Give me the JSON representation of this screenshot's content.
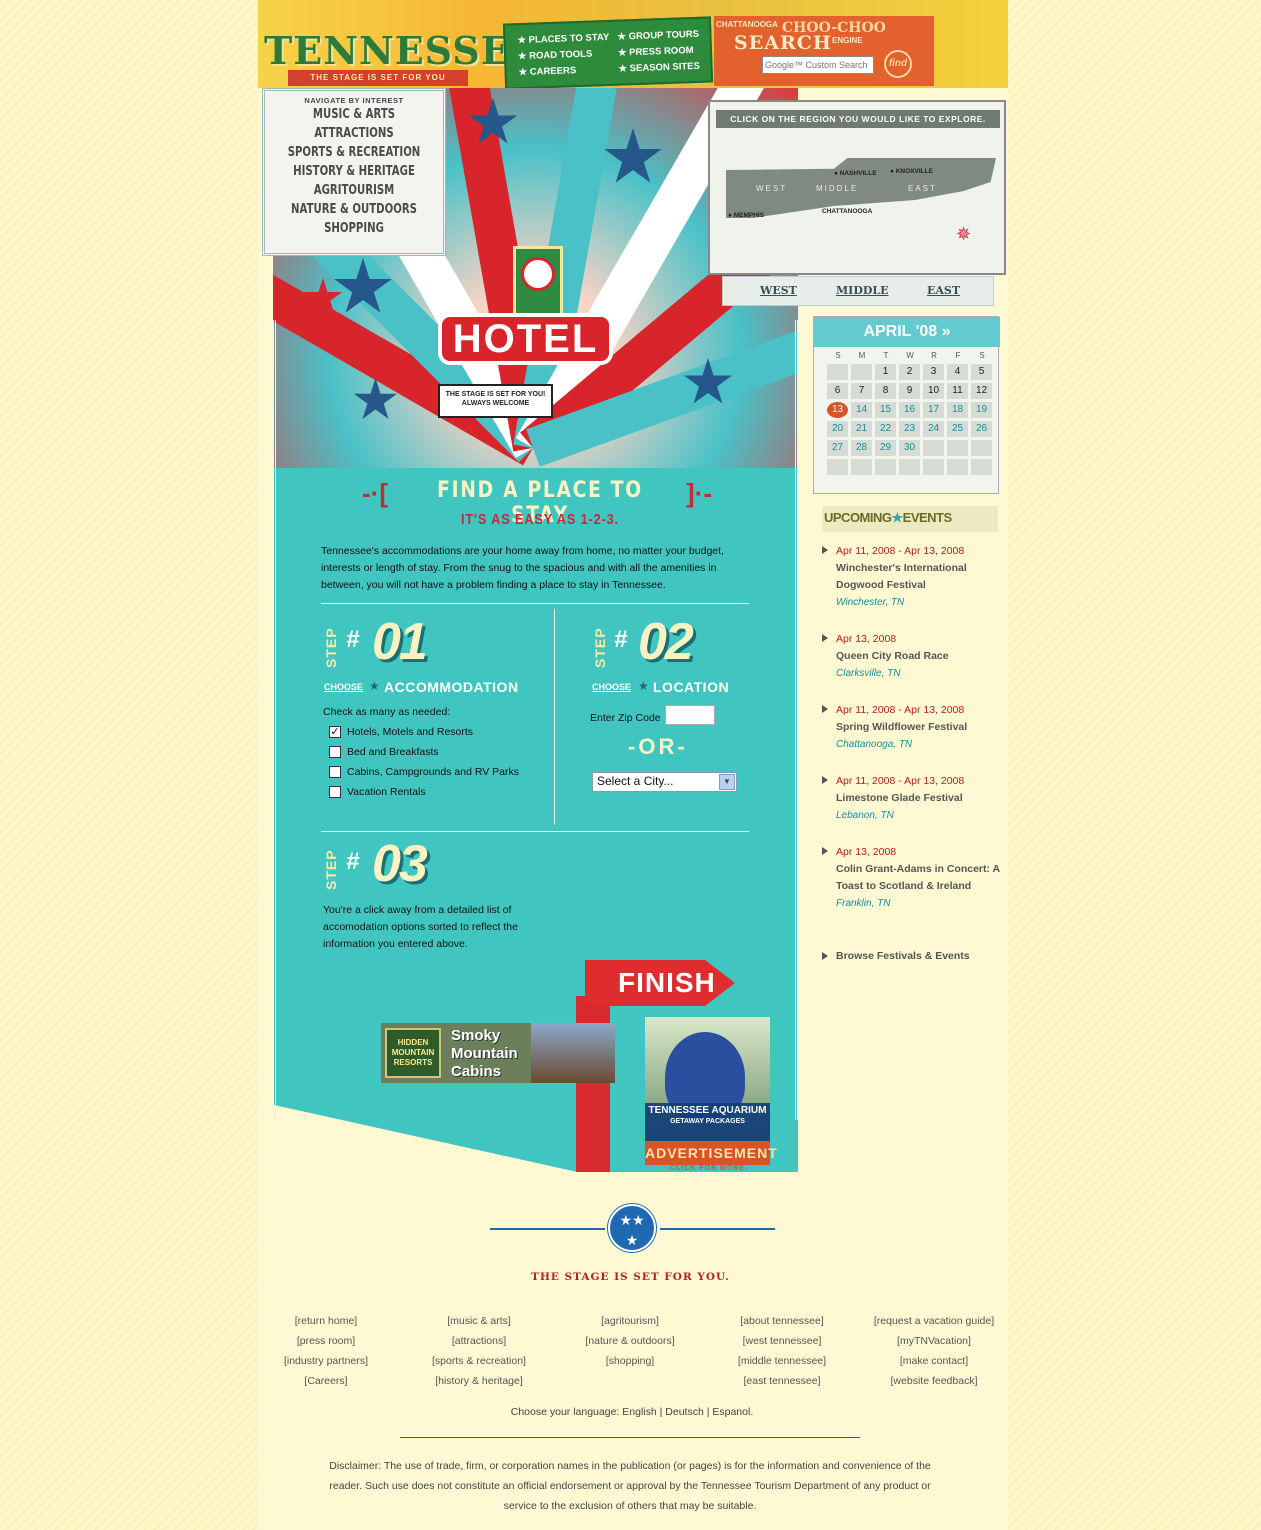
{
  "header": {
    "logo_text": "TENNESSEE",
    "logo_tagline": "THE STAGE IS SET FOR YOU",
    "nav": [
      "PLACES TO STAY",
      "GROUP TOURS",
      "ROAD TOOLS",
      "PRESS ROOM",
      "CAREERS",
      "SEASON SITES"
    ],
    "search_brand_small": "CHATTANOOGA",
    "search_brand_big": "CHOO-CHOO",
    "search_brand_engine": "ENGINE",
    "search_title": "SEARCH",
    "search_placeholder": "Google™ Custom Search",
    "find_label": "find"
  },
  "interest_nav": {
    "label": "NAVIGATE BY INTEREST",
    "items": [
      "MUSIC & ARTS",
      "ATTRACTIONS",
      "SPORTS & RECREATION",
      "HISTORY & HERITAGE",
      "AGRITOURISM",
      "NATURE & OUTDOORS",
      "SHOPPING"
    ]
  },
  "hero": {
    "sign_text": "HOTEL",
    "welcome_text": "THE STAGE IS SET FOR YOU! ALWAYS WELCOME"
  },
  "map": {
    "heading": "CLICK ON THE REGION YOU WOULD LIKE TO EXPLORE.",
    "regions": [
      "WEST",
      "MIDDLE",
      "EAST"
    ],
    "cities": [
      "NASHVILLE",
      "KNOXVILLE",
      "MEMPHIS",
      "CHATTANOOGA"
    ],
    "tabs": [
      "WEST",
      "MIDDLE",
      "EAST"
    ]
  },
  "calendar": {
    "title": "APRIL '08 »",
    "dow": [
      "S",
      "M",
      "T",
      "W",
      "R",
      "F",
      "S"
    ],
    "today": "13",
    "weeks": [
      [
        "",
        "",
        "1",
        "2",
        "3",
        "4",
        "5"
      ],
      [
        "6",
        "7",
        "8",
        "9",
        "10",
        "11",
        "12"
      ],
      [
        "13",
        "14",
        "15",
        "16",
        "17",
        "18",
        "19"
      ],
      [
        "20",
        "21",
        "22",
        "23",
        "24",
        "25",
        "26"
      ],
      [
        "27",
        "28",
        "29",
        "30",
        "",
        "",
        ""
      ],
      [
        "",
        "",
        "",
        "",
        "",
        "",
        ""
      ]
    ]
  },
  "upcoming": {
    "title_a": "UPCOMING",
    "title_star": "★",
    "title_b": "EVENTS",
    "events": [
      {
        "date": "Apr 11, 2008 - Apr 13, 2008",
        "name": "Winchester's International Dogwood Festival",
        "location": "Winchester, TN"
      },
      {
        "date": "Apr 13, 2008",
        "name": "Queen City Road Race",
        "location": "Clarksville, TN"
      },
      {
        "date": "Apr 11, 2008 - Apr 13, 2008",
        "name": "Spring Wildflower Festival",
        "location": "Chattanooga, TN"
      },
      {
        "date": "Apr 11, 2008 - Apr 13, 2008",
        "name": "Limestone Glade Festival",
        "location": "Lebanon, TN"
      },
      {
        "date": "Apr 13, 2008",
        "name": "Colin Grant-Adams in Concert: A Toast to Scotland & Ireland",
        "location": "Franklin, TN"
      }
    ],
    "browse": "Browse Festivals & Events"
  },
  "main": {
    "title": "FIND A PLACE TO STAY",
    "subtitle": "IT'S AS EASY AS 1-2-3.",
    "intro": "Tennessee's accommodations are your home away from home, no matter your budget, interests or length of stay. From the snug to the spacious and with all the amenities in between, you will not have a problem finding a place to stay in Tennessee.",
    "step_word": "STEP",
    "step_hash": "#",
    "step1": {
      "num": "01",
      "choose": "CHOOSE",
      "what": "ACCOMMODATION",
      "check_label": "Check as many as needed:",
      "options": [
        {
          "label": "Hotels, Motels and Resorts",
          "checked": true
        },
        {
          "label": "Bed and Breakfasts",
          "checked": false
        },
        {
          "label": "Cabins, Campgrounds and RV Parks",
          "checked": false
        },
        {
          "label": "Vacation Rentals",
          "checked": false
        }
      ]
    },
    "step2": {
      "num": "02",
      "choose": "CHOOSE",
      "what": "LOCATION",
      "zip_label": "Enter Zip Code",
      "or": "-OR-",
      "city_select": "Select a City..."
    },
    "step3": {
      "num": "03",
      "text": "You're a click away from a detailed list of accomodation options sorted to reflect the information you entered above."
    },
    "finish": "FINISH"
  },
  "ads": {
    "smoky_logo": "HIDDEN MOUNTAIN RESORTS",
    "smoky_text": "Smoky Mountain Cabins",
    "aquarium_name": "TENNESSEE AQUARIUM",
    "aquarium_sub": "GETAWAY PACKAGES",
    "advertisement": "ADVERTISEMENT",
    "click": "-CLICK FOR MORE-"
  },
  "footer": {
    "tagline": "THE STAGE IS SET FOR YOU.",
    "columns": [
      [
        "[return home]",
        "[press room]",
        "[industry partners]",
        "[Careers]"
      ],
      [
        "[music & arts]",
        "[attractions]",
        "[sports & recreation]",
        "[history & heritage]"
      ],
      [
        "[agritourism]",
        "[nature & outdoors]",
        "[shopping]"
      ],
      [
        "[about tennessee]",
        "[west tennessee]",
        "[middle tennessee]",
        "[east tennessee]"
      ],
      [
        "[request a vacation guide]",
        "[myTNVacation]",
        "[make contact]",
        "[website feedback]"
      ]
    ],
    "lang_label": "Choose your language:",
    "languages": [
      "English",
      "Deutsch",
      "Espanol"
    ],
    "disclaimer": "Disclaimer: The use of trade, firm, or corporation names in the publication (or pages) is for the information and convenience of the reader. Such use does not constitute an official endorsement or approval by the Tennessee Tourism Department of any product or service to the exclusion of others that may be suitable."
  },
  "colors": {
    "teal": "#41c5c0",
    "red": "#c8283a",
    "cream": "#fdf7c8",
    "green": "#2f8b3c",
    "orange": "#e2612c"
  }
}
